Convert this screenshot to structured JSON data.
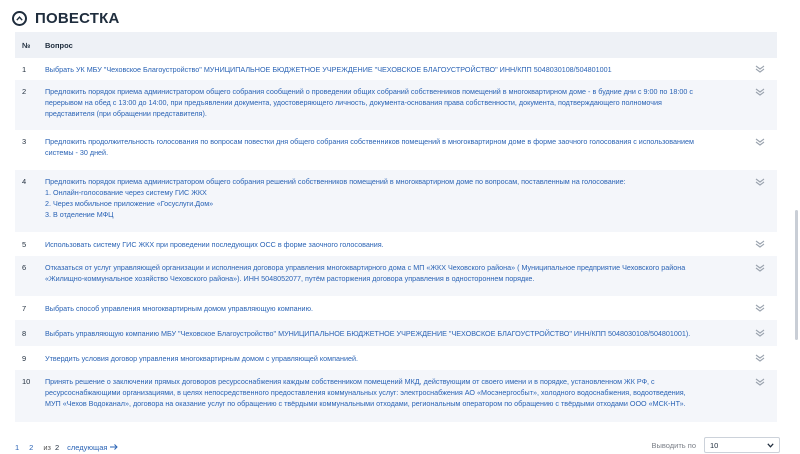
{
  "header": {
    "title": "ПОВЕСТКА",
    "toggle_icon": "chevron-up-circle-icon"
  },
  "table": {
    "col_num": "№",
    "col_question": "Вопрос",
    "rows": [
      {
        "num": "1",
        "lines": [
          "Выбрать УК МБУ \"Чеховское Благоустройство\" МУНИЦИПАЛЬНОЕ БЮДЖЕТНОЕ УЧРЕЖДЕНИЕ \"ЧЕХОВСКОЕ БЛАГОУСТРОЙСТВО\" ИНН/КПП 5048030108/504801001"
        ]
      },
      {
        "num": "2",
        "lines": [
          "Предложить порядок приема администратором общего собрания сообщений о проведении общих собраний собственников помещений в многоквартирном доме - в будние дни с 9:00 по 18:00 с",
          "перерывом на обед с 13:00 до 14:00, при предъявлении документа, удостоверяющего личность, документа-основания права собственности, документа, подтверждающего полномочия",
          "представителя (при обращении представителя)."
        ]
      },
      {
        "num": "3",
        "lines": [
          "Предложить продолжительность голосования по вопросам повестки дня общего собрания собственников помещений в многоквартирном доме в форме заочного голосования с использованием",
          "системы - 30 дней."
        ]
      },
      {
        "num": "4",
        "lines": [
          "Предложить порядок приема администратором общего собрания решений собственников помещений в многоквартирном доме по вопросам, поставленным на голосование:",
          "1. Онлайн-голосование через систему ГИС ЖКХ",
          "2. Через мобильное приложение «Госуслуги.Дом»",
          "3. В отделение МФЦ"
        ]
      },
      {
        "num": "5",
        "lines": [
          "Использовать систему ГИС ЖКХ  при проведении последующих ОСС в форме заочного голосования."
        ]
      },
      {
        "num": "6",
        "lines": [
          "Отказаться от услуг управляющей организации и исполнения договора управления многоквартирного дома с МП «ЖКХ Чеховского района» ( Муниципальное предприятие Чеховского района",
          "«Жилищно-коммунальное хозяйство Чеховского района»). ИНН 5048052077, путём расторжения договора управления в одностороннем порядке."
        ]
      },
      {
        "num": "7",
        "lines": [
          "Выбрать способ управления многоквартирным домом управляющую компанию."
        ]
      },
      {
        "num": "8",
        "lines": [
          "Выбрать управляющую компанию МБУ \"Чеховское Благоустройство\" МУНИЦИПАЛЬНОЕ БЮДЖЕТНОЕ УЧРЕЖДЕНИЕ \"ЧЕХОВСКОЕ БЛАГОУСТРОЙСТВО\" ИНН/КПП 5048030108/504801001)."
        ]
      },
      {
        "num": "9",
        "lines": [
          "Утвердить условия  договор управления многоквартирным домом с управляющей компанией."
        ]
      },
      {
        "num": "10",
        "lines": [
          "Принять решение о заключении прямых договоров ресурсоснабжения каждым собственником помещений МКД, действующим от своего имени и в порядке, установленном ЖК РФ, с",
          "ресурсоснабжающими организациями, в целях непосредственного предоставления коммунальных услуг: электроснабжения  АО «Мосэнергосбыт», холодного водоснабжения, водоотведения,",
          "МУП «Чехов  Водоканал», договора на оказание услуг по обращению с твёрдыми коммунальными отходами, региональным оператором по обращению с твёрдыми отходами ООО «МСК-НТ»."
        ]
      }
    ]
  },
  "pagination": {
    "pages": [
      "1",
      "2"
    ],
    "of_label": "из",
    "total": "2",
    "next_label": "следующая"
  },
  "per_page": {
    "label": "Выводить по",
    "value": "10"
  }
}
